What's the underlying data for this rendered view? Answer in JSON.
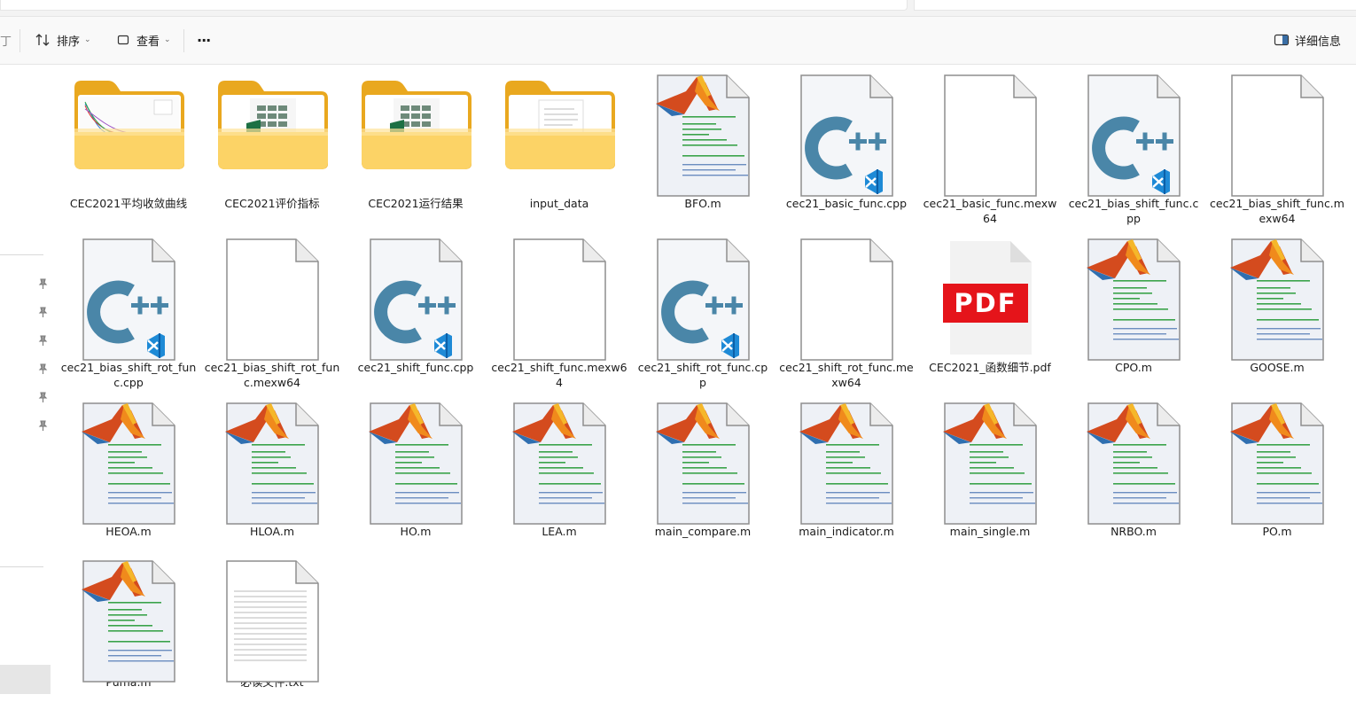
{
  "toolbar": {
    "sort_label": "排序",
    "view_label": "查看",
    "more_label": "···",
    "details_label": "详细信息"
  },
  "files": [
    {
      "name": "CEC2021平均收敛曲线",
      "type": "folder-chart"
    },
    {
      "name": "CEC2021评价指标",
      "type": "folder-excel"
    },
    {
      "name": "CEC2021运行结果",
      "type": "folder-excel"
    },
    {
      "name": "input_data",
      "type": "folder-doc"
    },
    {
      "name": "BFO.m",
      "type": "matlab"
    },
    {
      "name": "cec21_basic_func.cpp",
      "type": "cpp"
    },
    {
      "name": "cec21_basic_func.mexw64",
      "type": "blank"
    },
    {
      "name": "cec21_bias_shift_func.cpp",
      "type": "cpp"
    },
    {
      "name": "cec21_bias_shift_func.mexw64",
      "type": "blank"
    },
    {
      "name": "cec21_bias_shift_rot_func.cpp",
      "type": "cpp"
    },
    {
      "name": "cec21_bias_shift_rot_func.mexw64",
      "type": "blank"
    },
    {
      "name": "cec21_shift_func.cpp",
      "type": "cpp"
    },
    {
      "name": "cec21_shift_func.mexw64",
      "type": "blank"
    },
    {
      "name": "cec21_shift_rot_func.cpp",
      "type": "cpp"
    },
    {
      "name": "cec21_shift_rot_func.mexw64",
      "type": "blank"
    },
    {
      "name": "CEC2021_函数细节.pdf",
      "type": "pdf",
      "badge": "PDF"
    },
    {
      "name": "CPO.m",
      "type": "matlab"
    },
    {
      "name": "GOOSE.m",
      "type": "matlab"
    },
    {
      "name": "HEOA.m",
      "type": "matlab"
    },
    {
      "name": "HLOA.m",
      "type": "matlab"
    },
    {
      "name": "HO.m",
      "type": "matlab"
    },
    {
      "name": "LEA.m",
      "type": "matlab"
    },
    {
      "name": "main_compare.m",
      "type": "matlab"
    },
    {
      "name": "main_indicator.m",
      "type": "matlab"
    },
    {
      "name": "main_single.m",
      "type": "matlab"
    },
    {
      "name": "NRBO.m",
      "type": "matlab"
    },
    {
      "name": "PO.m",
      "type": "matlab"
    },
    {
      "name": "Puma.m",
      "type": "matlab"
    },
    {
      "name": "必读文件.txt",
      "type": "txt"
    }
  ],
  "colors": {
    "folder_back": "#e9a81f",
    "folder_front": "#fcd366",
    "cpp_blue": "#4a86a8",
    "vscode_blue": "#1e8ad6",
    "pdf_red": "#e5141a",
    "excel_green": "#1d7044"
  }
}
